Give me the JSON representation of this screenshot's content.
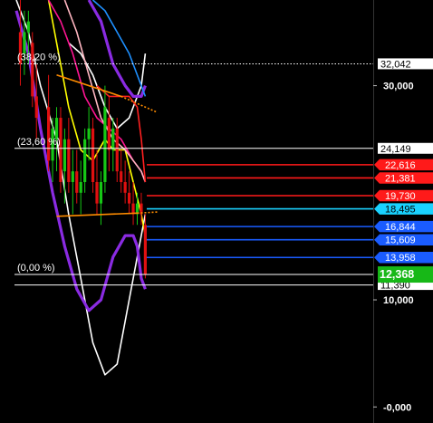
{
  "chart_data": {
    "type": "line",
    "ylim": [
      -1.5,
      38.0
    ],
    "grid": false,
    "y_ticks": [
      {
        "value": 30.0,
        "label": "30,000"
      },
      {
        "value": 10.0,
        "label": "10,000"
      },
      {
        "value": 0.0,
        "label": "-0,000"
      }
    ],
    "fib_levels": [
      {
        "label": "(38,20 %)",
        "value": 32.042,
        "value_label": "32,042",
        "style": "dotted"
      },
      {
        "label": "(23,60 %)",
        "value": 24.149,
        "value_label": "24,149",
        "style": "solid"
      },
      {
        "label": "(0,00 %)",
        "value": 12.368,
        "value_label": "",
        "style": "solid"
      }
    ],
    "horizontal_levels": [
      {
        "value": 22.616,
        "label": "22,616",
        "color": "#ff1a1a"
      },
      {
        "value": 21.381,
        "label": "21,381",
        "color": "#ff1a1a"
      },
      {
        "value": 19.73,
        "label": "19,730",
        "color": "#ff1a1a"
      },
      {
        "value": 18.495,
        "label": "18,495",
        "color": "#1ad2ff"
      },
      {
        "value": 16.844,
        "label": "16,844",
        "color": "#1a5cff"
      },
      {
        "value": 15.609,
        "label": "15,609",
        "color": "#1a5cff"
      },
      {
        "value": 13.958,
        "label": "13,958",
        "color": "#1a5cff"
      }
    ],
    "last_price": {
      "value": 12.368,
      "label": "12,368",
      "color": "#17b817"
    },
    "low_tag": {
      "value": 11.39,
      "label": "11,390"
    },
    "series": [
      {
        "color": "#ffffff",
        "x": [
          0,
          3,
          6,
          10,
          13,
          16,
          19,
          22,
          25,
          28,
          32
        ],
        "y": [
          38,
          35,
          30,
          25,
          18,
          12,
          6,
          3,
          4,
          10,
          18
        ]
      },
      {
        "color": "#ffffff",
        "x": [
          13,
          16,
          19,
          22,
          25,
          28,
          31,
          32
        ],
        "y": [
          34,
          33,
          31,
          28,
          26,
          27,
          30,
          33
        ]
      },
      {
        "color": "#8a2be2",
        "x": [
          0,
          3,
          6,
          9,
          12,
          15,
          18,
          21,
          24,
          27,
          29,
          30,
          31,
          32
        ],
        "y": [
          37,
          33,
          26,
          20,
          15,
          11,
          9,
          10,
          14,
          16,
          16,
          15,
          12,
          11
        ]
      },
      {
        "color": "#8a2be2",
        "x": [
          18,
          21,
          24,
          27,
          29,
          31,
          32
        ],
        "y": [
          38,
          36,
          32,
          30,
          29,
          29,
          30
        ]
      },
      {
        "color": "#ffff00",
        "x": [
          8,
          10,
          13,
          16,
          19,
          22,
          24,
          27,
          29,
          31,
          32
        ],
        "y": [
          38,
          34,
          28,
          24,
          23,
          25,
          24,
          24,
          21,
          18,
          16
        ]
      },
      {
        "color": "#ff1493",
        "x": [
          8,
          11,
          14,
          17,
          20,
          23,
          26,
          29,
          31,
          32
        ],
        "y": [
          38,
          36,
          33,
          29,
          27,
          26,
          25,
          23,
          22,
          21
        ]
      },
      {
        "color": "#ffb6c1",
        "x": [
          12,
          15,
          18,
          21,
          24,
          27,
          29,
          31,
          32
        ],
        "y": [
          38,
          35,
          31,
          27,
          25,
          24,
          23,
          22,
          21
        ]
      },
      {
        "color": "#1e90ff",
        "x": [
          19,
          22,
          25,
          28,
          31,
          32
        ],
        "y": [
          38,
          37,
          35,
          33,
          30,
          29
        ]
      },
      {
        "color": "#ff2020",
        "x": [
          20,
          23,
          26,
          28,
          30,
          31,
          32
        ],
        "y": [
          30,
          29,
          29,
          29,
          28,
          25,
          21
        ]
      }
    ],
    "candles": [
      {
        "x": 1,
        "o": 35,
        "h": 38,
        "l": 30,
        "c": 32
      },
      {
        "x": 2,
        "o": 33,
        "h": 37,
        "l": 31,
        "c": 35
      },
      {
        "x": 3,
        "o": 35,
        "h": 37,
        "l": 32,
        "c": 36
      },
      {
        "x": 4,
        "o": 34,
        "h": 35,
        "l": 28,
        "c": 29
      },
      {
        "x": 5,
        "o": 29,
        "h": 32,
        "l": 25,
        "c": 27
      },
      {
        "x": 8,
        "o": 28,
        "h": 31,
        "l": 22,
        "c": 23
      },
      {
        "x": 9,
        "o": 23,
        "h": 27,
        "l": 21,
        "c": 26
      },
      {
        "x": 10,
        "o": 25,
        "h": 28,
        "l": 22,
        "c": 27
      },
      {
        "x": 11,
        "o": 27,
        "h": 28,
        "l": 20,
        "c": 21
      },
      {
        "x": 12,
        "o": 22,
        "h": 26,
        "l": 19,
        "c": 25
      },
      {
        "x": 13,
        "o": 25,
        "h": 27,
        "l": 20,
        "c": 21
      },
      {
        "x": 14,
        "o": 21,
        "h": 24,
        "l": 18,
        "c": 22
      },
      {
        "x": 15,
        "o": 22,
        "h": 24,
        "l": 19,
        "c": 20
      },
      {
        "x": 16,
        "o": 20,
        "h": 23,
        "l": 18,
        "c": 21
      },
      {
        "x": 17,
        "o": 21,
        "h": 26,
        "l": 20,
        "c": 25
      },
      {
        "x": 18,
        "o": 25,
        "h": 28,
        "l": 23,
        "c": 26
      },
      {
        "x": 19,
        "o": 26,
        "h": 27,
        "l": 20,
        "c": 21
      },
      {
        "x": 20,
        "o": 21,
        "h": 24,
        "l": 18,
        "c": 19
      },
      {
        "x": 21,
        "o": 19,
        "h": 22,
        "l": 17,
        "c": 21
      },
      {
        "x": 22,
        "o": 21,
        "h": 30,
        "l": 20,
        "c": 28
      },
      {
        "x": 23,
        "o": 27,
        "h": 29,
        "l": 22,
        "c": 24
      },
      {
        "x": 24,
        "o": 24,
        "h": 27,
        "l": 22,
        "c": 26
      },
      {
        "x": 25,
        "o": 26,
        "h": 27,
        "l": 21,
        "c": 22
      },
      {
        "x": 26,
        "o": 22,
        "h": 24,
        "l": 20,
        "c": 21
      },
      {
        "x": 27,
        "o": 21,
        "h": 23,
        "l": 19,
        "c": 20
      },
      {
        "x": 28,
        "o": 20,
        "h": 22,
        "l": 18,
        "c": 19
      },
      {
        "x": 29,
        "o": 19,
        "h": 21,
        "l": 17,
        "c": 18
      },
      {
        "x": 30,
        "o": 18,
        "h": 20,
        "l": 17,
        "c": 19
      },
      {
        "x": 31,
        "o": 19,
        "h": 20,
        "l": 17,
        "c": 18
      },
      {
        "x": 32,
        "o": 17,
        "h": 18,
        "l": 12,
        "c": 12.4
      }
    ],
    "trendlines": [
      {
        "color": "#ff8c00",
        "points": [
          [
            10,
            31
          ],
          [
            26,
            29
          ],
          [
            35,
            27.5
          ]
        ],
        "dashed_from": 1
      },
      {
        "color": "#ff8c00",
        "points": [
          [
            10,
            17.8
          ],
          [
            30,
            18.1
          ],
          [
            35,
            18.2
          ]
        ],
        "dashed_from": 1
      }
    ]
  }
}
